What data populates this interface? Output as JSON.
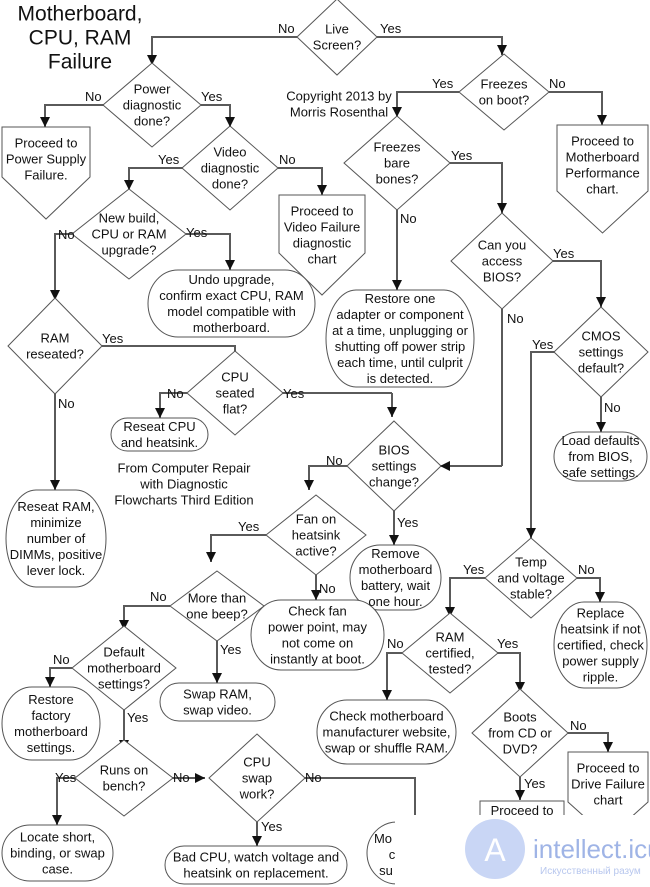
{
  "title": [
    "Motherboard,",
    "CPU, RAM",
    "Failure"
  ],
  "copyright": [
    "Copyright 2013 by",
    "Morris Rosenthal"
  ],
  "source_note": [
    "From Computer Repair",
    "with Diagnostic",
    "Flowcharts Third Edition"
  ],
  "decisions": {
    "live_screen": [
      "Live",
      "Screen?"
    ],
    "power_diag": [
      "Power",
      "diagnostic",
      "done?"
    ],
    "video_diag": [
      "Video",
      "diagnostic",
      "done?"
    ],
    "new_build": [
      "New build,",
      "CPU or RAM",
      "upgrade?"
    ],
    "ram_reseated": [
      "RAM",
      "reseated?"
    ],
    "cpu_seated": [
      "CPU",
      "seated",
      "flat?"
    ],
    "freezes_boot": [
      "Freezes",
      "on boot?"
    ],
    "freezes_bare": [
      "Freezes",
      "bare",
      "bones?"
    ],
    "access_bios": [
      "Can you",
      "access",
      "BIOS?"
    ],
    "cmos_default": [
      "CMOS",
      "settings",
      "default?"
    ],
    "bios_change": [
      "BIOS",
      "settings",
      "change?"
    ],
    "fan_active": [
      "Fan on",
      "heatsink",
      "active?"
    ],
    "more_beep": [
      "More than",
      "one beep?"
    ],
    "default_mb": [
      "Default",
      "motherboard",
      "settings?"
    ],
    "runs_bench": [
      "Runs on",
      "bench?"
    ],
    "cpu_swap": [
      "CPU",
      "swap",
      "work?"
    ],
    "temp_voltage": [
      "Temp",
      "and voltage",
      "stable?"
    ],
    "ram_certified": [
      "RAM",
      "certified,",
      "tested?"
    ],
    "boots_cd": [
      "Boots",
      "from CD or",
      "DVD?"
    ]
  },
  "offpage": {
    "power_supply": [
      "Proceed to",
      "Power Supply",
      "Failure."
    ],
    "video_failure": [
      "Proceed to",
      "Video Failure",
      "diagnostic",
      "chart"
    ],
    "mb_performance": [
      "Proceed to",
      "Motherboard",
      "Performance",
      "chart."
    ],
    "drive_failure": [
      "Proceed to",
      "Drive Failure",
      "chart"
    ],
    "proceed_bottom": [
      "Proceed to"
    ]
  },
  "actions": {
    "undo_upgrade": [
      "Undo upgrade,",
      "confirm  exact CPU, RAM",
      "model compatible with",
      "motherboard."
    ],
    "restore_one": [
      "Restore one",
      "adapter or component",
      "at a time, unplugging or",
      "shutting off power strip",
      "each time, until culprit",
      "is detected."
    ],
    "reseat_cpu": [
      "Reseat CPU",
      "and heatsink."
    ],
    "reseat_ram": [
      "Reseat RAM,",
      "minimize",
      "number of",
      "DIMMs, positive",
      "lever lock."
    ],
    "load_defaults": [
      "Load defaults",
      "from BIOS,",
      "safe settings."
    ],
    "remove_battery": [
      "Remove",
      "motherboard",
      "battery, wait",
      "one hour."
    ],
    "check_fan": [
      "Check fan",
      "power point, may",
      "not come on",
      "instantly at boot."
    ],
    "swap_ram": [
      "Swap RAM,",
      "swap video."
    ],
    "restore_factory": [
      "Restore",
      "factory",
      "motherboard",
      "settings."
    ],
    "check_mb_site": [
      "Check motherboard",
      "manufacturer website,",
      "swap or shuffle RAM."
    ],
    "replace_heatsink": [
      "Replace",
      "heatsink if not",
      "certified, check",
      "power supply",
      "ripple."
    ],
    "locate_short": [
      "Locate short,",
      "binding, or swap",
      "case."
    ],
    "bad_cpu": [
      "Bad CPU, watch voltage and",
      "heatsink on replacement."
    ],
    "partial_mo": [
      "Mo",
      "c",
      "su"
    ]
  },
  "labels": {
    "yes": "Yes",
    "no": "No"
  },
  "watermark": {
    "brand": "intellect.icu",
    "tagline": "Искусственный разум"
  },
  "colors": {
    "line": "#5a5a5a",
    "shape_stroke": "#555555",
    "watermark": "#9fb4e6"
  }
}
